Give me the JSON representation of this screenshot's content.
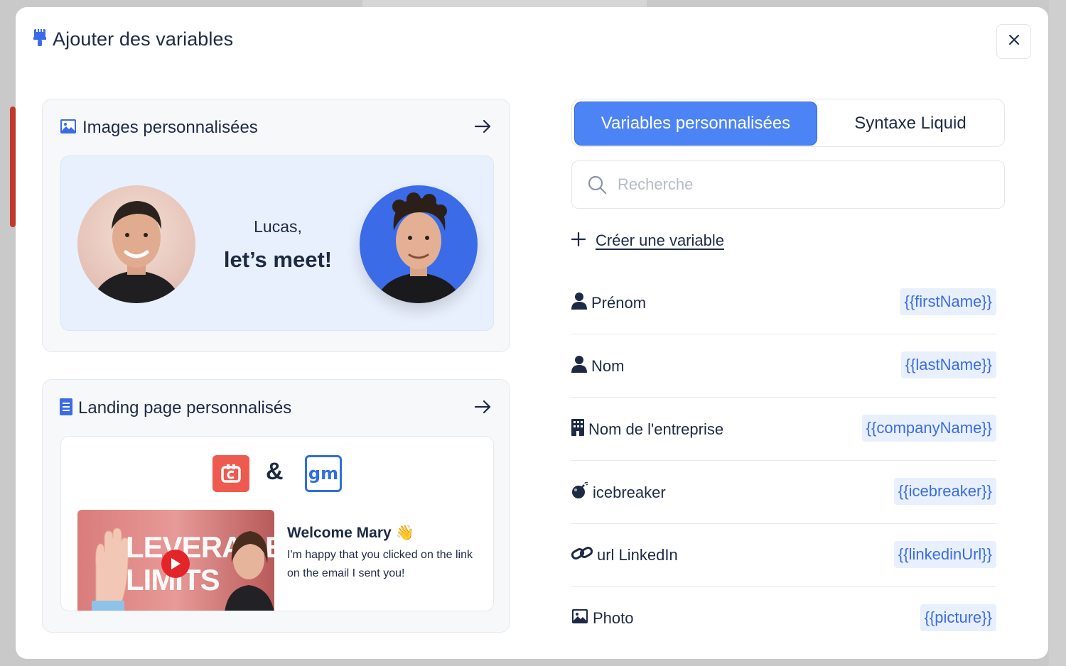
{
  "modal": {
    "title": "Ajouter des variables",
    "close_icon": "close-icon"
  },
  "cards": {
    "images": {
      "title": "Images personnalisées",
      "icon": "image-icon",
      "preview": {
        "name": "Lucas,",
        "message": "let’s meet!"
      }
    },
    "landing": {
      "title": "Landing page personnalisés",
      "icon": "document-icon",
      "preview": {
        "ampersand": "&",
        "right_logo": "gm",
        "video_text": "LEVERAGE LIMITS",
        "welcome_title": "Welcome Mary 👋",
        "welcome_text": "I'm happy that you clicked on the link on the email I sent you!"
      }
    }
  },
  "tabs": [
    {
      "label": "Variables personnalisées",
      "active": true
    },
    {
      "label": "Syntaxe Liquid",
      "active": false
    }
  ],
  "search": {
    "placeholder": "Recherche",
    "value": ""
  },
  "create_variable": {
    "label": "Créer une variable"
  },
  "variables": [
    {
      "label": "Prénom",
      "tag": "{{firstName}}",
      "icon": "user-icon"
    },
    {
      "label": "Nom",
      "tag": "{{lastName}}",
      "icon": "user-icon"
    },
    {
      "label": "Nom de l'entreprise",
      "tag": "{{companyName}}",
      "icon": "building-icon"
    },
    {
      "label": "icebreaker",
      "tag": "{{icebreaker}}",
      "icon": "bomb-icon"
    },
    {
      "label": "url LinkedIn",
      "tag": "{{linkedinUrl}}",
      "icon": "link-icon"
    },
    {
      "label": "Photo",
      "tag": "{{picture}}",
      "icon": "image-icon"
    }
  ],
  "colors": {
    "accent": "#4d84f5",
    "text": "#1e2a44",
    "tag_bg": "#e8f0fd",
    "tag_text": "#3b6be6"
  }
}
